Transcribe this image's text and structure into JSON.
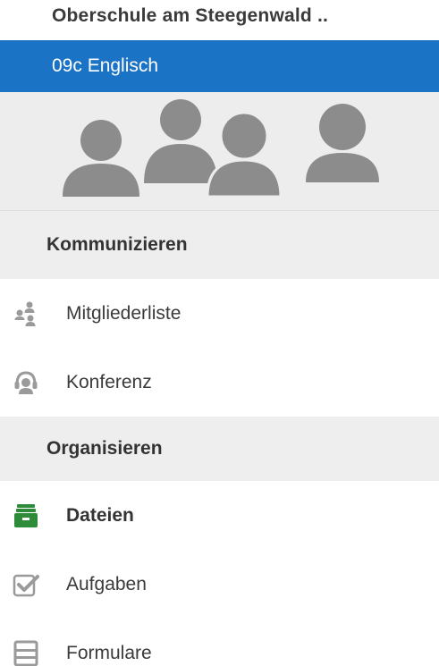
{
  "header": {
    "organization": "Oberschule am Steegenwald ..",
    "group_name": "09c Englisch"
  },
  "sections": [
    {
      "title": "Kommunizieren",
      "items": [
        {
          "label": "Mitgliederliste",
          "icon": "members-icon"
        },
        {
          "label": "Konferenz",
          "icon": "conference-headset-icon"
        }
      ]
    },
    {
      "title": "Organisieren",
      "items": [
        {
          "label": "Dateien",
          "icon": "files-drawer-icon",
          "active": true,
          "color": "#2e8b3a"
        },
        {
          "label": "Aufgaben",
          "icon": "tasks-checkbox-icon"
        },
        {
          "label": "Formulare",
          "icon": "forms-icon"
        }
      ]
    }
  ],
  "colors": {
    "accent": "#1a73c4",
    "section_bg": "#eeeeee",
    "avatar": "#8c8c8c",
    "icon_gray": "#9a9a9a",
    "active_icon": "#2e8b3a"
  }
}
